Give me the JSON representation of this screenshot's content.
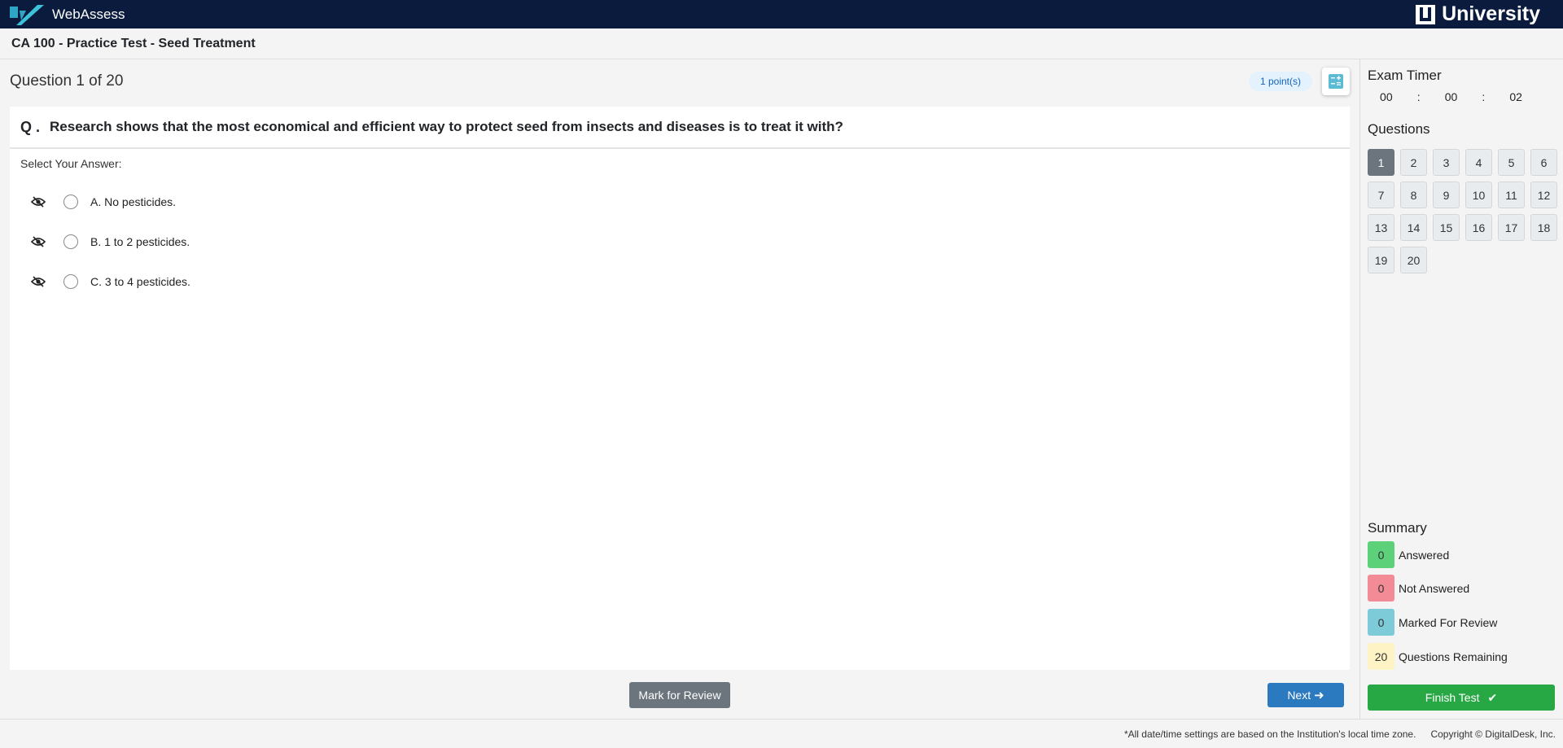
{
  "app": {
    "brand": "WebAssess",
    "university": "University"
  },
  "course": {
    "title": "CA 100 - Practice Test - Seed Treatment"
  },
  "question": {
    "counter": "Question 1 of 20",
    "points": "1 point(s)",
    "label": "Q .",
    "text": "Research shows that the most economical and efficient way to protect seed from insects and diseases is to treat it with?",
    "select_label": "Select Your Answer:",
    "options": [
      {
        "text": "A. No pesticides."
      },
      {
        "text": "B. 1 to 2 pesticides."
      },
      {
        "text": "C. 3 to 4 pesticides."
      }
    ]
  },
  "actions": {
    "mark_review": "Mark for Review",
    "next": "Next",
    "next_icon": "arrow-right-icon"
  },
  "sidebar": {
    "timer_title": "Exam Timer",
    "timer": {
      "hours": "00",
      "minutes": "00",
      "seconds": "02",
      "separator": ":"
    },
    "questions_title": "Questions",
    "questions": [
      "1",
      "2",
      "3",
      "4",
      "5",
      "6",
      "7",
      "8",
      "9",
      "10",
      "11",
      "12",
      "13",
      "14",
      "15",
      "16",
      "17",
      "18",
      "19",
      "20"
    ],
    "current_question": "1",
    "summary_title": "Summary",
    "summary": [
      {
        "count": "0",
        "label": "Answered",
        "color": "#5cd17a"
      },
      {
        "count": "0",
        "label": "Not Answered",
        "color": "#f28b96"
      },
      {
        "count": "0",
        "label": "Marked For Review",
        "color": "#7dcad8"
      },
      {
        "count": "20",
        "label": "Questions Remaining",
        "color": "#fdf3c4"
      }
    ],
    "finish": "Finish Test"
  },
  "footer": {
    "timezone_note": "*All date/time settings are based on the Institution's local time zone.",
    "copyright": "Copyright © DigitalDesk, Inc."
  },
  "colors": {
    "topbar": "#0a1b3d",
    "primary": "#2b7ac0",
    "success": "#28a745",
    "secondary": "#6c757d"
  }
}
